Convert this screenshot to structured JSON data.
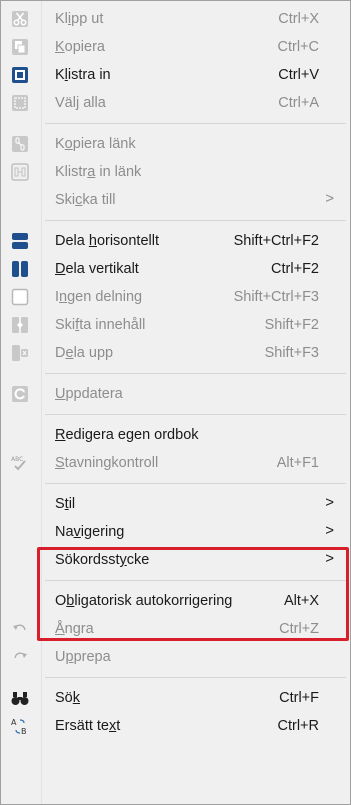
{
  "menu": {
    "items": [
      {
        "label_html": "Kl<u>i</u>pp ut",
        "shortcut": "Ctrl+X",
        "disabled": true,
        "icon": "scissors-icon"
      },
      {
        "label_html": "<u>K</u>opiera",
        "shortcut": "Ctrl+C",
        "disabled": true,
        "icon": "copy-icon"
      },
      {
        "label_html": "K<u>l</u>istra in",
        "shortcut": "Ctrl+V",
        "disabled": false,
        "icon": "paste-icon"
      },
      {
        "label_html": "Väl<u>j</u> alla",
        "shortcut": "Ctrl+A",
        "disabled": true,
        "icon": "select-all-icon"
      },
      {
        "sep": true
      },
      {
        "label_html": "K<u>o</u>piera länk",
        "shortcut": "",
        "disabled": true,
        "icon": "copy-link-icon"
      },
      {
        "label_html": "Klistr<u>a</u> in länk",
        "shortcut": "",
        "disabled": true,
        "icon": "paste-link-icon"
      },
      {
        "label_html": "Ski<u>c</u>ka till",
        "shortcut": "",
        "disabled": true,
        "submenu": true,
        "icon": ""
      },
      {
        "sep": true
      },
      {
        "label_html": "Dela <u>h</u>orisontellt",
        "shortcut": "Shift+Ctrl+F2",
        "disabled": false,
        "icon": "split-horizontal-icon"
      },
      {
        "label_html": "<u>D</u>ela vertikalt",
        "shortcut": "Ctrl+F2",
        "disabled": false,
        "icon": "split-vertical-icon"
      },
      {
        "label_html": "I<u>n</u>gen delning",
        "shortcut": "Shift+Ctrl+F3",
        "disabled": true,
        "icon": "no-split-icon"
      },
      {
        "label_html": "Ski<u>f</u>ta innehåll",
        "shortcut": "Shift+F2",
        "disabled": true,
        "icon": "swap-content-icon"
      },
      {
        "label_html": "D<u>e</u>la upp",
        "shortcut": "Shift+F3",
        "disabled": true,
        "icon": "split-up-icon"
      },
      {
        "sep": true
      },
      {
        "label_html": "<u>U</u>ppdatera",
        "shortcut": "",
        "disabled": true,
        "icon": "refresh-icon"
      },
      {
        "sep": true
      },
      {
        "label_html": "<u>R</u>edigera egen ordbok",
        "shortcut": "",
        "disabled": false,
        "icon": ""
      },
      {
        "label_html": "<u>S</u>tavningkontroll",
        "shortcut": "Alt+F1",
        "disabled": true,
        "icon": "spellcheck-icon"
      },
      {
        "sep": true
      },
      {
        "label_html": "S<u>t</u>il",
        "shortcut": "",
        "disabled": false,
        "submenu": true,
        "icon": ""
      },
      {
        "label_html": "Na<u>v</u>igering",
        "shortcut": "",
        "disabled": false,
        "submenu": true,
        "icon": ""
      },
      {
        "label_html": "Sökordsst<u>y</u>cke",
        "shortcut": "",
        "disabled": false,
        "submenu": true,
        "icon": ""
      },
      {
        "sep": true
      },
      {
        "label_html": "O<u>b</u>ligatorisk autokorrigering",
        "shortcut": "Alt+X",
        "disabled": false,
        "icon": ""
      },
      {
        "label_html": "<u>Å</u>ngra",
        "shortcut": "Ctrl+Z",
        "disabled": true,
        "icon": "undo-icon"
      },
      {
        "label_html": "U<u>p</u>prepa",
        "shortcut": "",
        "disabled": true,
        "icon": "redo-icon"
      },
      {
        "sep": true
      },
      {
        "label_html": "Sö<u>k</u>",
        "shortcut": "Ctrl+F",
        "disabled": false,
        "icon": "binoculars-icon"
      },
      {
        "label_html": "Ersätt te<u>x</u>t",
        "shortcut": "Ctrl+R",
        "disabled": false,
        "icon": "replace-text-icon"
      }
    ],
    "submenu_arrow": ">",
    "highlight_color": "#d81e2a"
  }
}
